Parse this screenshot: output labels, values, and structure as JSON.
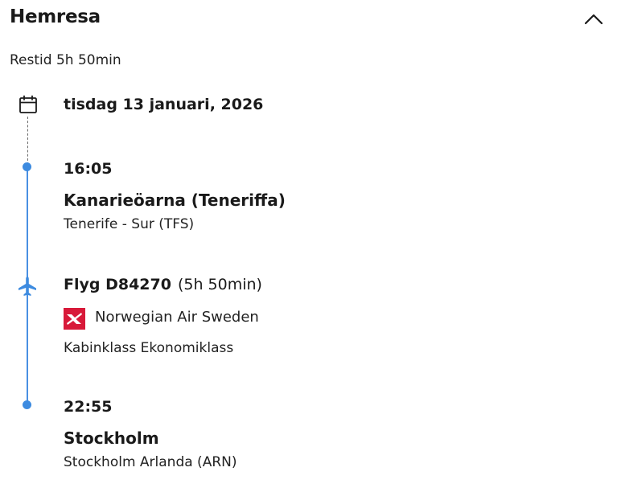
{
  "section": {
    "title": "Hemresa",
    "travel_time": "Restid 5h 50min"
  },
  "date": "tisdag 13 januari, 2026",
  "departure": {
    "time": "16:05",
    "place": "Kanarieöarna (Teneriffa)",
    "airport": "Tenerife - Sur (TFS)"
  },
  "flight": {
    "number": "Flyg D84270",
    "duration": "(5h 50min)",
    "airline": "Norwegian Air Sweden",
    "cabin": "Kabinklass Ekonomiklass"
  },
  "arrival": {
    "time": "22:55",
    "place": "Stockholm",
    "airport": "Stockholm Arlanda (ARN)"
  },
  "colors": {
    "timeline_blue": "#3d8be0",
    "airline_red": "#d81939"
  },
  "icons": [
    "chevron-up-icon",
    "calendar-icon",
    "airplane-icon",
    "norwegian-logo"
  ]
}
